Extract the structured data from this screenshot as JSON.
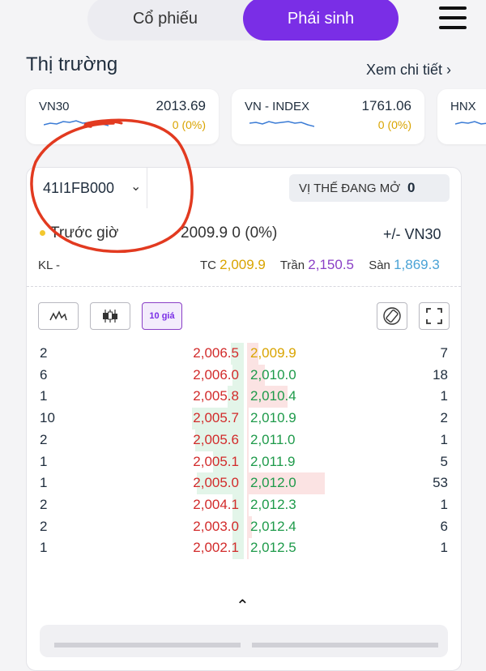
{
  "header": {
    "tabs": [
      {
        "label": "Cổ phiếu",
        "active": false
      },
      {
        "label": "Phái sinh",
        "active": true
      }
    ],
    "menu_icon": "hamburger-menu-icon"
  },
  "market": {
    "title": "Thị trường",
    "see_more": "Xem chi tiết ›"
  },
  "indices": [
    {
      "name": "VN30",
      "value": "2013.69",
      "change": "0 (0%)"
    },
    {
      "name": "VN - INDEX",
      "value": "1761.06",
      "change": "0 (0%)"
    },
    {
      "name": "HNX",
      "value": "",
      "change": ""
    }
  ],
  "contract": {
    "code": "41I1FB000",
    "open_position_label": "VỊ THẾ ĐANG MỞ",
    "open_position_value": "0",
    "session_label": "Trước giờ",
    "price": "2009.9",
    "price_change": "0 (0%)",
    "vs_index_label": "+/- VN30",
    "volume_label": "KL",
    "volume_value": "-",
    "ref_label": "TC",
    "ref_value": "2,009.9",
    "ceiling_label": "Trần",
    "ceiling_value": "2,150.5",
    "floor_label": "Sàn",
    "floor_value": "1,869.3"
  },
  "toolbar": {
    "ten_prices_label": "10 giá"
  },
  "order_book": [
    {
      "bid_qty": "2",
      "bid_price": "2,006.5",
      "ask_price": "2,009.9",
      "ask_qty": "7",
      "ask_color": "gold"
    },
    {
      "bid_qty": "6",
      "bid_price": "2,006.0",
      "ask_price": "2,010.0",
      "ask_qty": "18",
      "ask_color": "green"
    },
    {
      "bid_qty": "1",
      "bid_price": "2,005.8",
      "ask_price": "2,010.4",
      "ask_qty": "1",
      "ask_color": "green"
    },
    {
      "bid_qty": "10",
      "bid_price": "2,005.7",
      "ask_price": "2,010.9",
      "ask_qty": "2",
      "ask_color": "green"
    },
    {
      "bid_qty": "2",
      "bid_price": "2,005.6",
      "ask_price": "2,011.0",
      "ask_qty": "1",
      "ask_color": "green"
    },
    {
      "bid_qty": "1",
      "bid_price": "2,005.1",
      "ask_price": "2,011.9",
      "ask_qty": "5",
      "ask_color": "green"
    },
    {
      "bid_qty": "1",
      "bid_price": "2,005.0",
      "ask_price": "2,012.0",
      "ask_qty": "53",
      "ask_color": "green"
    },
    {
      "bid_qty": "2",
      "bid_price": "2,004.1",
      "ask_price": "2,012.3",
      "ask_qty": "1",
      "ask_color": "green"
    },
    {
      "bid_qty": "2",
      "bid_price": "2,003.0",
      "ask_price": "2,012.4",
      "ask_qty": "6",
      "ask_color": "green"
    },
    {
      "bid_qty": "1",
      "bid_price": "2,002.1",
      "ask_price": "2,012.5",
      "ask_qty": "1",
      "ask_color": "green"
    }
  ],
  "colors": {
    "accent": "#7a2ee6",
    "bid_price": "#d22b2b",
    "ask_price": "#1e9a4a",
    "ref": "#d9a400",
    "ceiling": "#8a3fc6",
    "floor": "#4aa3d6"
  }
}
